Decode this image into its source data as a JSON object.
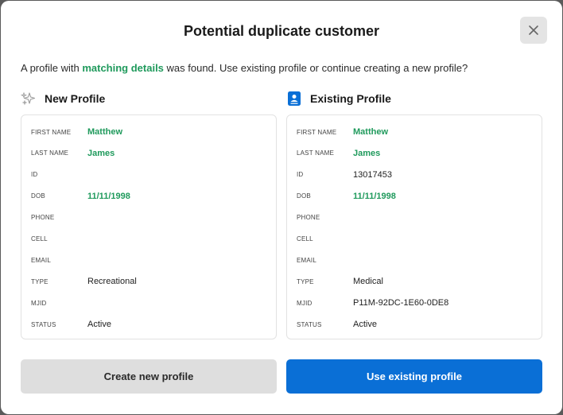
{
  "dialog": {
    "title": "Potential duplicate customer",
    "description_before": "A profile with ",
    "description_highlight": "matching details",
    "description_after": " was found. Use existing profile or continue creating a new profile?",
    "close_icon": "close-icon"
  },
  "new_profile": {
    "heading": "New Profile",
    "icon": "sparkles-icon",
    "fields": [
      {
        "label": "FIRST NAME",
        "value": "Matthew",
        "match": true
      },
      {
        "label": "LAST NAME",
        "value": "James",
        "match": true
      },
      {
        "label": "ID",
        "value": "",
        "match": false
      },
      {
        "label": "DOB",
        "value": "11/11/1998",
        "match": true
      },
      {
        "label": "PHONE",
        "value": "",
        "match": false
      },
      {
        "label": "CELL",
        "value": "",
        "match": false
      },
      {
        "label": "EMAIL",
        "value": "",
        "match": false
      },
      {
        "label": "TYPE",
        "value": "Recreational",
        "match": false
      },
      {
        "label": "MJID",
        "value": "",
        "match": false
      },
      {
        "label": "STATUS",
        "value": "Active",
        "match": false
      }
    ]
  },
  "existing_profile": {
    "heading": "Existing Profile",
    "icon": "profile-card-icon",
    "fields": [
      {
        "label": "FIRST NAME",
        "value": "Matthew",
        "match": true
      },
      {
        "label": "LAST NAME",
        "value": "James",
        "match": true
      },
      {
        "label": "ID",
        "value": "13017453",
        "match": false
      },
      {
        "label": "DOB",
        "value": "11/11/1998",
        "match": true
      },
      {
        "label": "PHONE",
        "value": "",
        "match": false
      },
      {
        "label": "CELL",
        "value": "",
        "match": false
      },
      {
        "label": "EMAIL",
        "value": "",
        "match": false
      },
      {
        "label": "TYPE",
        "value": "Medical",
        "match": false
      },
      {
        "label": "MJID",
        "value": "P11M-92DC-1E60-0DE8",
        "match": false
      },
      {
        "label": "STATUS",
        "value": "Active",
        "match": false
      }
    ]
  },
  "actions": {
    "create_label": "Create new profile",
    "use_existing_label": "Use existing profile"
  },
  "colors": {
    "match": "#1f9a5c",
    "primary": "#0a6fd6",
    "secondary": "#dedede"
  }
}
